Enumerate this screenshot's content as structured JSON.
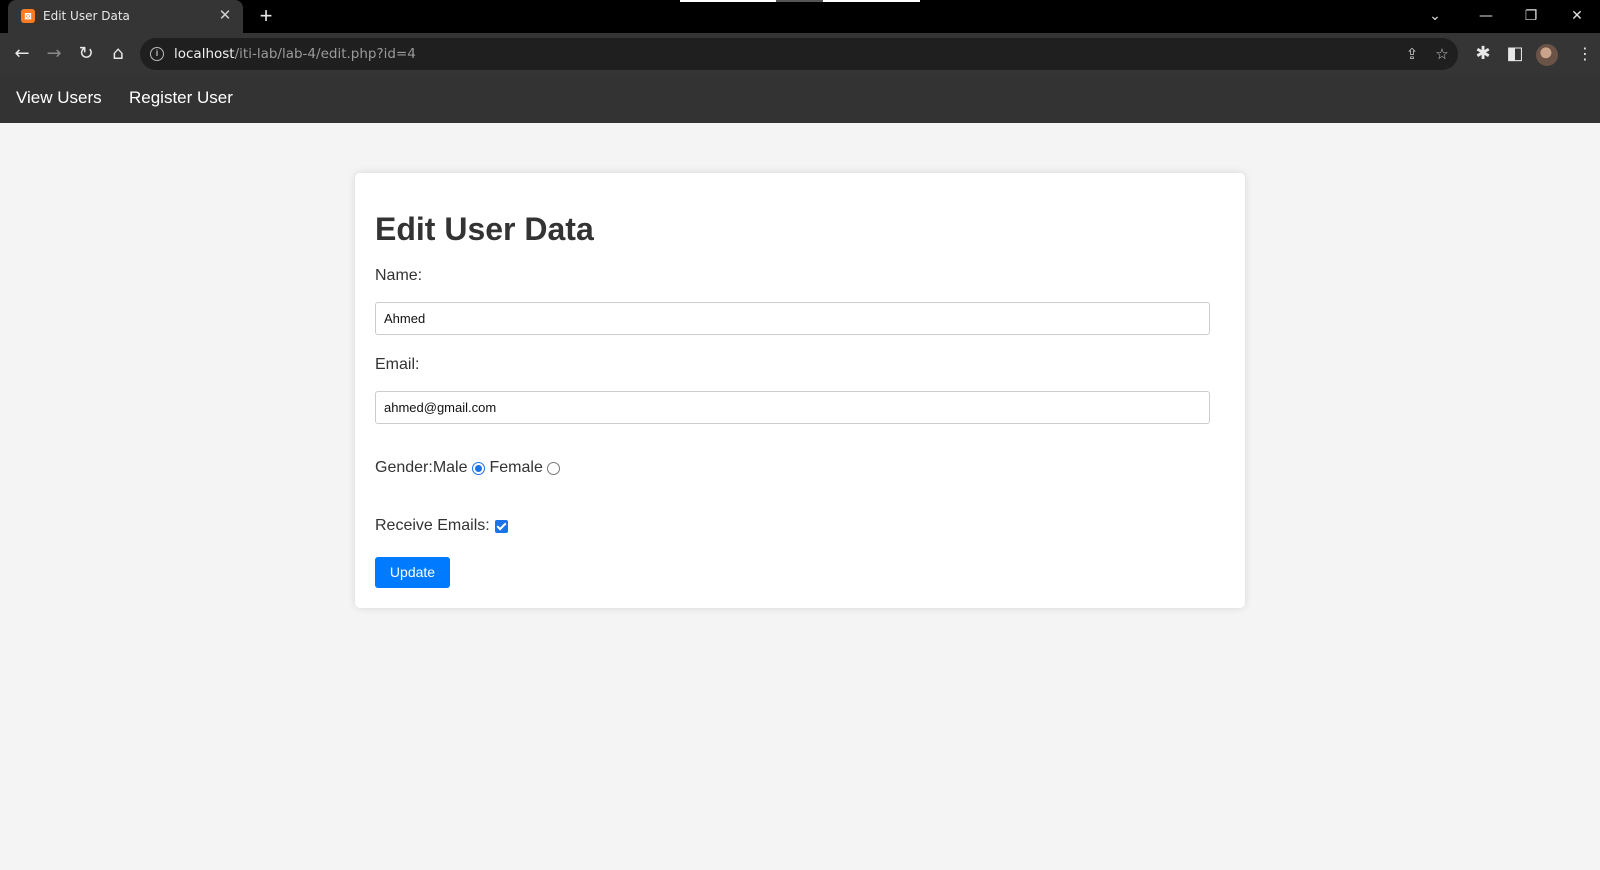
{
  "browser": {
    "tab_title": "Edit User Data",
    "favicon_text": "⊠",
    "url_host": "localhost",
    "url_path": "/iti-lab/lab-4/edit.php?id=4"
  },
  "nav": {
    "view_users": "View Users",
    "register_user": "Register User"
  },
  "form": {
    "title": "Edit User Data",
    "name_label": "Name:",
    "name_value": "Ahmed",
    "email_label": "Email:",
    "email_value": "ahmed@gmail.com",
    "gender_label": "Gender:",
    "gender_male": "Male",
    "gender_female": "Female",
    "gender_selected": "Male",
    "receive_label": "Receive Emails:",
    "receive_checked": true,
    "submit_label": "Update"
  },
  "colors": {
    "accent": "#007bff",
    "nav_bg": "#333333",
    "page_bg": "#f4f4f4"
  }
}
